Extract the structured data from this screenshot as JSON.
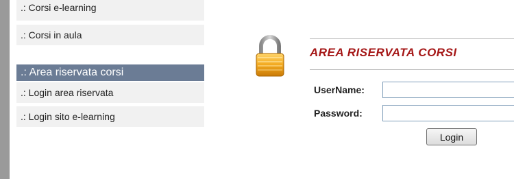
{
  "sidebar": {
    "items_top": [
      ".: Corsi e-learning",
      ".: Corsi in aula"
    ],
    "section_title": ".: Area riservata corsi",
    "items_section": [
      ".: Login area riservata",
      ".: Login sito e-learning"
    ]
  },
  "login_panel": {
    "icon": "padlock-icon",
    "title": "AREA RISERVATA CORSI",
    "username_label": "UserName:",
    "password_label": "Password:",
    "username_value": "",
    "password_value": "",
    "login_label": "Login"
  },
  "colors": {
    "title": "#a51717",
    "section_header_bg": "#6b7c95",
    "menu_item_bg": "#f1f1f1",
    "left_bar": "#9a9a9a"
  }
}
